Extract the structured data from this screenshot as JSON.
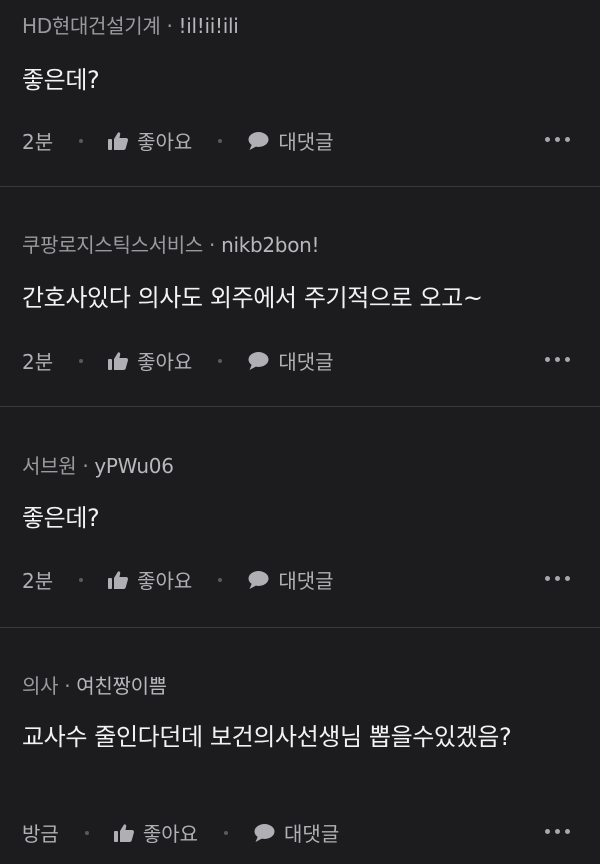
{
  "labels": {
    "like": "좋아요",
    "reply": "대댓글"
  },
  "comments": [
    {
      "company": "HD현대건설기계",
      "nickname": "!il!ii!ili",
      "text": "좋은데?",
      "time": "2분"
    },
    {
      "company": "쿠팡로지스틱스서비스",
      "nickname": "nikb2bon!",
      "text": "간호사있다 의사도 외주에서 주기적으로 오고~",
      "time": "2분"
    },
    {
      "company": "서브원",
      "nickname": "yPWu06",
      "text": "좋은데?",
      "time": "2분"
    },
    {
      "company": "의사",
      "nickname": "여친짱이쁨",
      "text": "교사수 줄인다던데 보건의사선생님 뽑을수있겠음?",
      "time": "방금"
    }
  ]
}
